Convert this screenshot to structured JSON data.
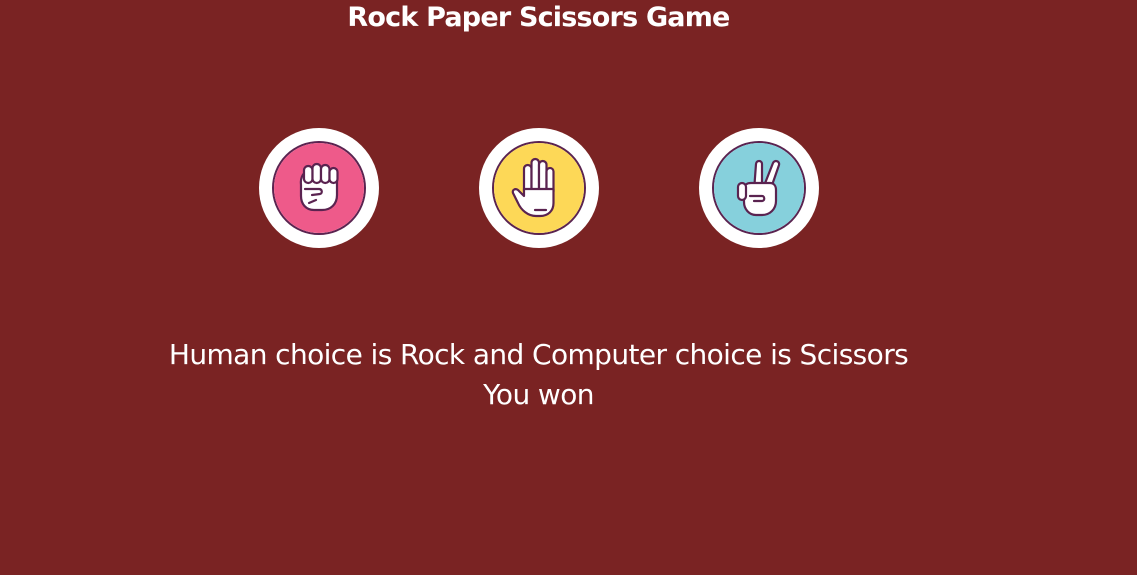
{
  "page": {
    "title": "Rock Paper Scissors Game"
  },
  "choices": [
    {
      "label": "Rock",
      "icon": "fist-icon",
      "color": "#ee5a8a"
    },
    {
      "label": "Paper",
      "icon": "open-hand-icon",
      "color": "#fdd857"
    },
    {
      "label": "Scissors",
      "icon": "victory-hand-icon",
      "color": "#86d0dc"
    }
  ],
  "result": {
    "choices_text": "Human choice is Rock and Computer choice is Scissors",
    "outcome": "You won"
  },
  "colors": {
    "background": "#7a2323",
    "text": "#ffffff",
    "icon_outline": "#5a2350"
  }
}
